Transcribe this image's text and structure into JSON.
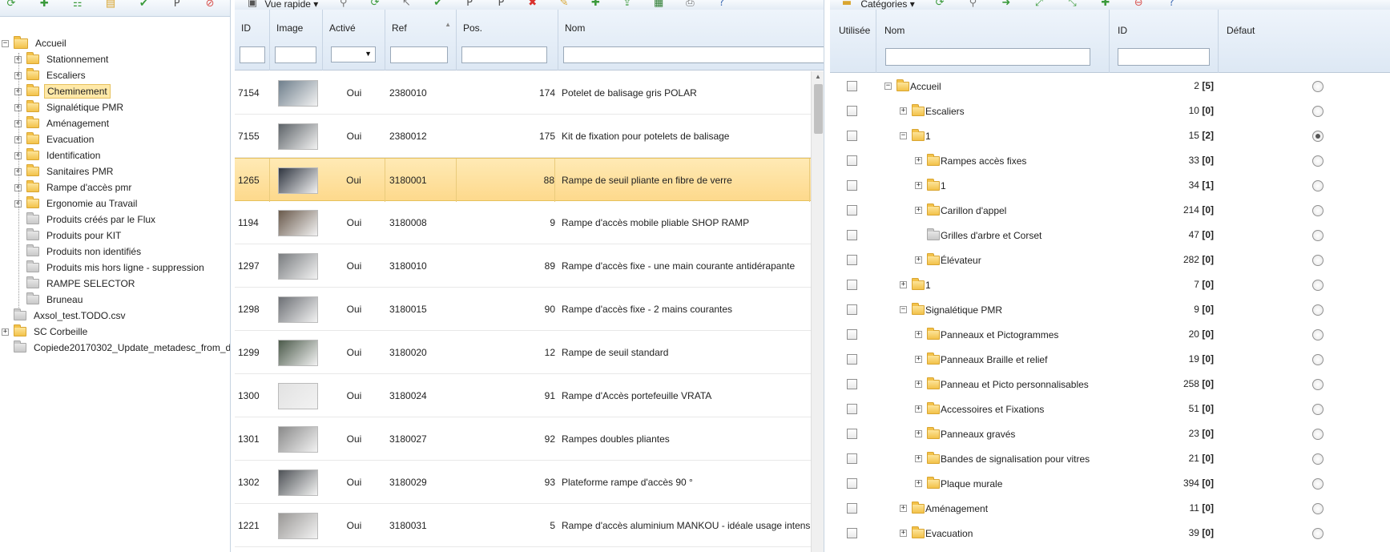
{
  "left_tree": {
    "toolbar_icons": [
      "refresh-icon",
      "add-category-icon",
      "tree-structure-icon",
      "edit-folder-icon",
      "validate-icon",
      "seo-icon",
      "delete-folder-icon"
    ],
    "nodes": [
      {
        "label": "Accueil",
        "level": 0,
        "expander": "−",
        "icon": "folder-open",
        "selected": false
      },
      {
        "label": "Stationnement",
        "level": 1,
        "expander": "+",
        "icon": "folder",
        "selected": false
      },
      {
        "label": "Escaliers",
        "level": 1,
        "expander": "+",
        "icon": "folder",
        "selected": false
      },
      {
        "label": "Cheminement",
        "level": 1,
        "expander": "+",
        "icon": "folder",
        "selected": true
      },
      {
        "label": "Signalétique PMR",
        "level": 1,
        "expander": "+",
        "icon": "folder",
        "selected": false
      },
      {
        "label": "Aménagement",
        "level": 1,
        "expander": "+",
        "icon": "folder",
        "selected": false
      },
      {
        "label": "Evacuation",
        "level": 1,
        "expander": "+",
        "icon": "folder",
        "selected": false
      },
      {
        "label": "Identification",
        "level": 1,
        "expander": "+",
        "icon": "folder",
        "selected": false
      },
      {
        "label": "Sanitaires PMR",
        "level": 1,
        "expander": "+",
        "icon": "folder",
        "selected": false
      },
      {
        "label": "Rampe d'accès pmr",
        "level": 1,
        "expander": "+",
        "icon": "folder",
        "selected": false
      },
      {
        "label": "Ergonomie au Travail",
        "level": 1,
        "expander": "+",
        "icon": "folder",
        "selected": false
      },
      {
        "label": "Produits créés par le Flux",
        "level": 1,
        "expander": "",
        "icon": "folder-gray",
        "selected": false
      },
      {
        "label": "Produits pour KIT",
        "level": 1,
        "expander": "",
        "icon": "folder-gray",
        "selected": false
      },
      {
        "label": "Produits non identifiés",
        "level": 1,
        "expander": "",
        "icon": "folder-gray",
        "selected": false
      },
      {
        "label": "Produits mis hors ligne - suppression",
        "level": 1,
        "expander": "",
        "icon": "folder-gray",
        "selected": false
      },
      {
        "label": "RAMPE SELECTOR",
        "level": 1,
        "expander": "",
        "icon": "folder-gray",
        "selected": false
      },
      {
        "label": "Bruneau",
        "level": 1,
        "expander": "",
        "icon": "folder-gray",
        "selected": false
      },
      {
        "label": "Axsol_test.TODO.csv",
        "level": 0,
        "expander": "",
        "icon": "folder-gray",
        "selected": false
      },
      {
        "label": "SC Corbeille",
        "level": 0,
        "expander": "+",
        "icon": "folder-trash",
        "selected": false
      },
      {
        "label": "Copiede20170302_Update_metadesc_from_d",
        "level": 0,
        "expander": "",
        "icon": "folder-gray",
        "selected": false
      }
    ]
  },
  "product_grid": {
    "toolbar": {
      "view_label": "Vue rapide",
      "icons": [
        "views-icon",
        "filter-icon",
        "refresh-icon",
        "select-icon",
        "validate-icon",
        "seo-icon",
        "seo-page-icon",
        "delete-icon",
        "edit-icon",
        "add-icon",
        "export-icon",
        "excel-icon",
        "print-icon",
        "help-icon"
      ]
    },
    "columns": {
      "id": "ID",
      "image": "Image",
      "active": "Activé",
      "ref": "Ref",
      "pos": "Pos.",
      "name": "Nom"
    },
    "rows": [
      {
        "id": "7154",
        "active": "Oui",
        "ref": "2380010",
        "pos": "174",
        "name": "Potelet de balisage gris POLAR",
        "thumb_color": "#6f7f8c",
        "selected": false
      },
      {
        "id": "7155",
        "active": "Oui",
        "ref": "2380012",
        "pos": "175",
        "name": "Kit de fixation pour potelets de balisage",
        "thumb_color": "#5d6368",
        "selected": false
      },
      {
        "id": "1265",
        "active": "Oui",
        "ref": "3180001",
        "pos": "88",
        "name": "Rampe de seuil pliante en fibre de verre",
        "thumb_color": "#2f3540",
        "selected": true
      },
      {
        "id": "1194",
        "active": "Oui",
        "ref": "3180008",
        "pos": "9",
        "name": "Rampe d'accès mobile pliable SHOP RAMP",
        "thumb_color": "#6a5a4c",
        "selected": false
      },
      {
        "id": "1297",
        "active": "Oui",
        "ref": "3180010",
        "pos": "89",
        "name": "Rampe d'accès fixe - une main courante antidérapante",
        "thumb_color": "#7a7d80",
        "selected": false
      },
      {
        "id": "1298",
        "active": "Oui",
        "ref": "3180015",
        "pos": "90",
        "name": "Rampe d'accès fixe - 2 mains courantes",
        "thumb_color": "#6d7075",
        "selected": false
      },
      {
        "id": "1299",
        "active": "Oui",
        "ref": "3180020",
        "pos": "12",
        "name": "Rampe de seuil standard",
        "thumb_color": "#4b5a4a",
        "selected": false
      },
      {
        "id": "1300",
        "active": "Oui",
        "ref": "3180024",
        "pos": "91",
        "name": "Rampe d'Accès portefeuille VRATA",
        "thumb_color": "#e2e2e2",
        "selected": false
      },
      {
        "id": "1301",
        "active": "Oui",
        "ref": "3180027",
        "pos": "92",
        "name": "Rampes doubles pliantes",
        "thumb_color": "#8a8a8a",
        "selected": false
      },
      {
        "id": "1302",
        "active": "Oui",
        "ref": "3180029",
        "pos": "93",
        "name": "Plateforme rampe d'accès 90 °",
        "thumb_color": "#4e5256",
        "selected": false
      },
      {
        "id": "1221",
        "active": "Oui",
        "ref": "3180031",
        "pos": "5",
        "name": "Rampe d'accès aluminium MANKOU - idéale usage intensif",
        "thumb_color": "#9a9896",
        "selected": false
      }
    ]
  },
  "categories": {
    "toolbar": {
      "view_label": "Catégories",
      "icons": [
        "folder-icon",
        "refresh-icon",
        "filter-icon",
        "goto-icon",
        "expand-icon",
        "collapse-icon",
        "add-icon",
        "remove-icon",
        "help-icon"
      ]
    },
    "columns": {
      "used": "Utilisée",
      "name": "Nom",
      "id": "ID",
      "default": "Défaut"
    },
    "rows": [
      {
        "label": "Accueil",
        "level": 0,
        "expander": "−",
        "icon": "folder",
        "id": "2",
        "count": "[5]",
        "default": false
      },
      {
        "label": "Escaliers",
        "level": 1,
        "expander": "+",
        "icon": "folder",
        "id": "10",
        "count": "[0]",
        "default": false
      },
      {
        "label": "1",
        "level": 1,
        "expander": "−",
        "icon": "folder",
        "id": "15",
        "count": "[2]",
        "default": true
      },
      {
        "label": "Rampes accès fixes",
        "level": 2,
        "expander": "+",
        "icon": "folder",
        "id": "33",
        "count": "[0]",
        "default": false
      },
      {
        "label": "1",
        "level": 2,
        "expander": "+",
        "icon": "folder",
        "id": "34",
        "count": "[1]",
        "default": false
      },
      {
        "label": "Carillon d'appel",
        "level": 2,
        "expander": "+",
        "icon": "folder",
        "id": "214",
        "count": "[0]",
        "default": false
      },
      {
        "label": "Grilles d'arbre et Corset",
        "level": 2,
        "expander": "",
        "icon": "folder-gray",
        "id": "47",
        "count": "[0]",
        "default": false
      },
      {
        "label": "Élévateur",
        "level": 2,
        "expander": "+",
        "icon": "folder",
        "id": "282",
        "count": "[0]",
        "default": false
      },
      {
        "label": "1",
        "level": 1,
        "expander": "+",
        "icon": "folder",
        "id": "7",
        "count": "[0]",
        "default": false
      },
      {
        "label": "Signalétique PMR",
        "level": 1,
        "expander": "−",
        "icon": "folder",
        "id": "9",
        "count": "[0]",
        "default": false
      },
      {
        "label": "Panneaux et Pictogrammes",
        "level": 2,
        "expander": "+",
        "icon": "folder",
        "id": "20",
        "count": "[0]",
        "default": false
      },
      {
        "label": "Panneaux Braille et relief",
        "level": 2,
        "expander": "+",
        "icon": "folder",
        "id": "19",
        "count": "[0]",
        "default": false
      },
      {
        "label": "Panneau et Picto personnalisables",
        "level": 2,
        "expander": "+",
        "icon": "folder",
        "id": "258",
        "count": "[0]",
        "default": false
      },
      {
        "label": "Accessoires et Fixations",
        "level": 2,
        "expander": "+",
        "icon": "folder",
        "id": "51",
        "count": "[0]",
        "default": false
      },
      {
        "label": "Panneaux gravés",
        "level": 2,
        "expander": "+",
        "icon": "folder",
        "id": "23",
        "count": "[0]",
        "default": false
      },
      {
        "label": "Bandes de signalisation pour vitres",
        "level": 2,
        "expander": "+",
        "icon": "folder",
        "id": "21",
        "count": "[0]",
        "default": false
      },
      {
        "label": "Plaque murale",
        "level": 2,
        "expander": "+",
        "icon": "folder",
        "id": "394",
        "count": "[0]",
        "default": false
      },
      {
        "label": "Aménagement",
        "level": 1,
        "expander": "+",
        "icon": "folder",
        "id": "11",
        "count": "[0]",
        "default": false
      },
      {
        "label": "Evacuation",
        "level": 1,
        "expander": "+",
        "icon": "folder",
        "id": "39",
        "count": "[0]",
        "default": false
      }
    ]
  }
}
